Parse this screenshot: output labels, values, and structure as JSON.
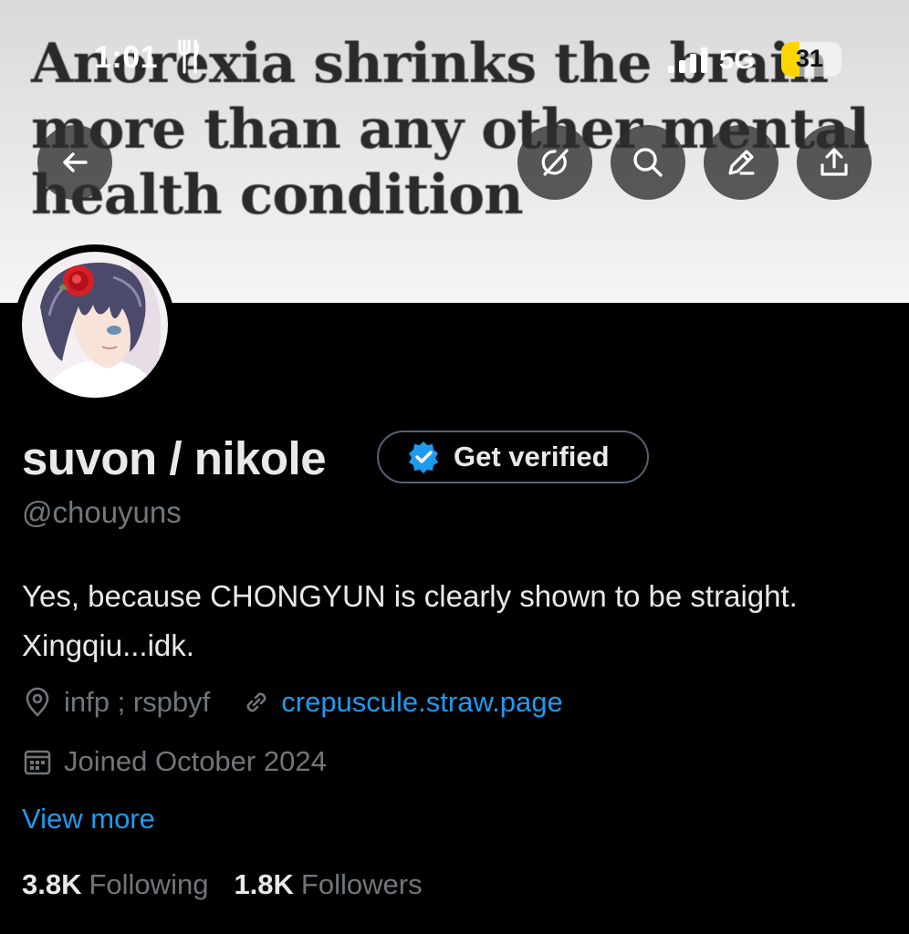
{
  "status_bar": {
    "time": "1:01",
    "network": "5G",
    "battery": "31",
    "battery_level": 0.31
  },
  "banner": {
    "headline": "Anorexia shrinks the brain more than any other mental health condition"
  },
  "header_buttons": {
    "back_icon": "arrow-left-icon",
    "grok_icon": "grok-slash-circle-icon",
    "search_icon": "search-icon",
    "edit_icon": "pencil-icon",
    "share_icon": "share-upload-icon"
  },
  "profile": {
    "display_name": "suvon / nikole",
    "verify_label": "Get verified",
    "handle": "@chouyuns",
    "bio": "Yes, because CHONGYUN is clearly shown to be straight. Xingqiu...idk.",
    "location": "infp ; rspbyf",
    "website": "crepuscule.straw.page",
    "joined": "Joined October 2024",
    "view_more": "View more"
  },
  "stats": {
    "following_count": "3.8K",
    "following_label": "Following",
    "followers_count": "1.8K",
    "followers_label": "Followers"
  },
  "colors": {
    "background": "#000000",
    "primary_text": "#e7e9ea",
    "secondary_text": "#71767b",
    "link": "#1d9bf0",
    "border": "#536471",
    "battery": "#ffd500"
  }
}
